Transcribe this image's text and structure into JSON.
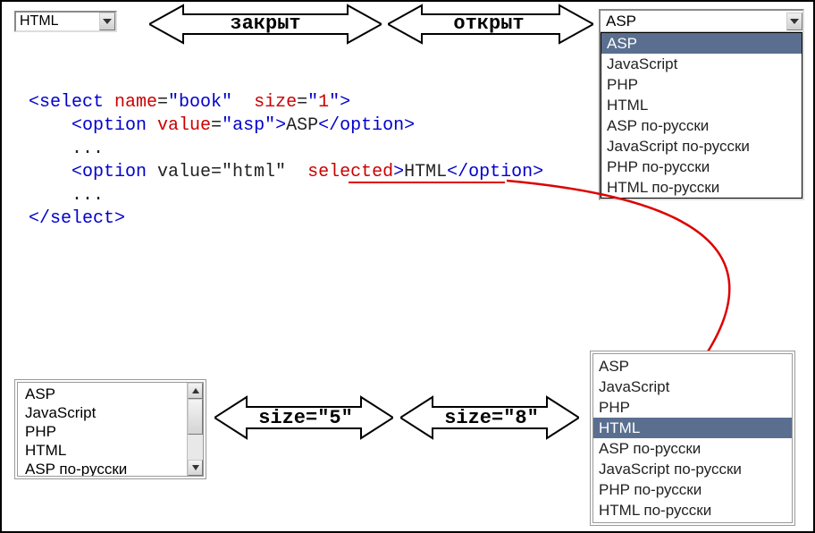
{
  "labels": {
    "closed": "закрыт",
    "open": "открыт",
    "size5": "size=\"5\"",
    "size8": "size=\"8\""
  },
  "closed_select": {
    "value": "HTML"
  },
  "open_select": {
    "value": "ASP",
    "options": [
      "ASP",
      "JavaScript",
      "PHP",
      "HTML",
      "ASP по-русски",
      "JavaScript по-русски",
      "PHP по-русски",
      "HTML по-русски"
    ],
    "selected": "ASP"
  },
  "size5": {
    "visible": [
      "ASP",
      "JavaScript",
      "PHP",
      "HTML",
      "ASP по-русски"
    ]
  },
  "size8": {
    "options": [
      "ASP",
      "JavaScript",
      "PHP",
      "HTML",
      "ASP по-русски",
      "JavaScript по-русски",
      "PHP по-русски",
      "HTML по-русски"
    ],
    "selected": "HTML"
  },
  "code": {
    "l1_open": "<select ",
    "l1_a1": "name",
    "l1_eq1": "=",
    "l1_v1": "\"book\"",
    "l1_sp": "  ",
    "l1_a2": "size",
    "l1_eq2": "=",
    "l1_q": "\"",
    "l1_n": "1",
    "l1_q2": "\"",
    "l1_close": ">",
    "l2_ind": "    ",
    "l2_open": "<option ",
    "l2_a": "value",
    "l2_eq": "=",
    "l2_v": "\"asp\"",
    "l2_close": ">",
    "l2_text": "ASP",
    "l2_end": "</option>",
    "l3": "    ...",
    "l4_ind": "    ",
    "l4_open": "<option ",
    "l4_a": "value=\"html\"  ",
    "l4_sel": "selected",
    "l4_close": ">",
    "l4_text": "HTML",
    "l4_end": "</option>",
    "l5": "    ...",
    "l6": "</select>"
  }
}
